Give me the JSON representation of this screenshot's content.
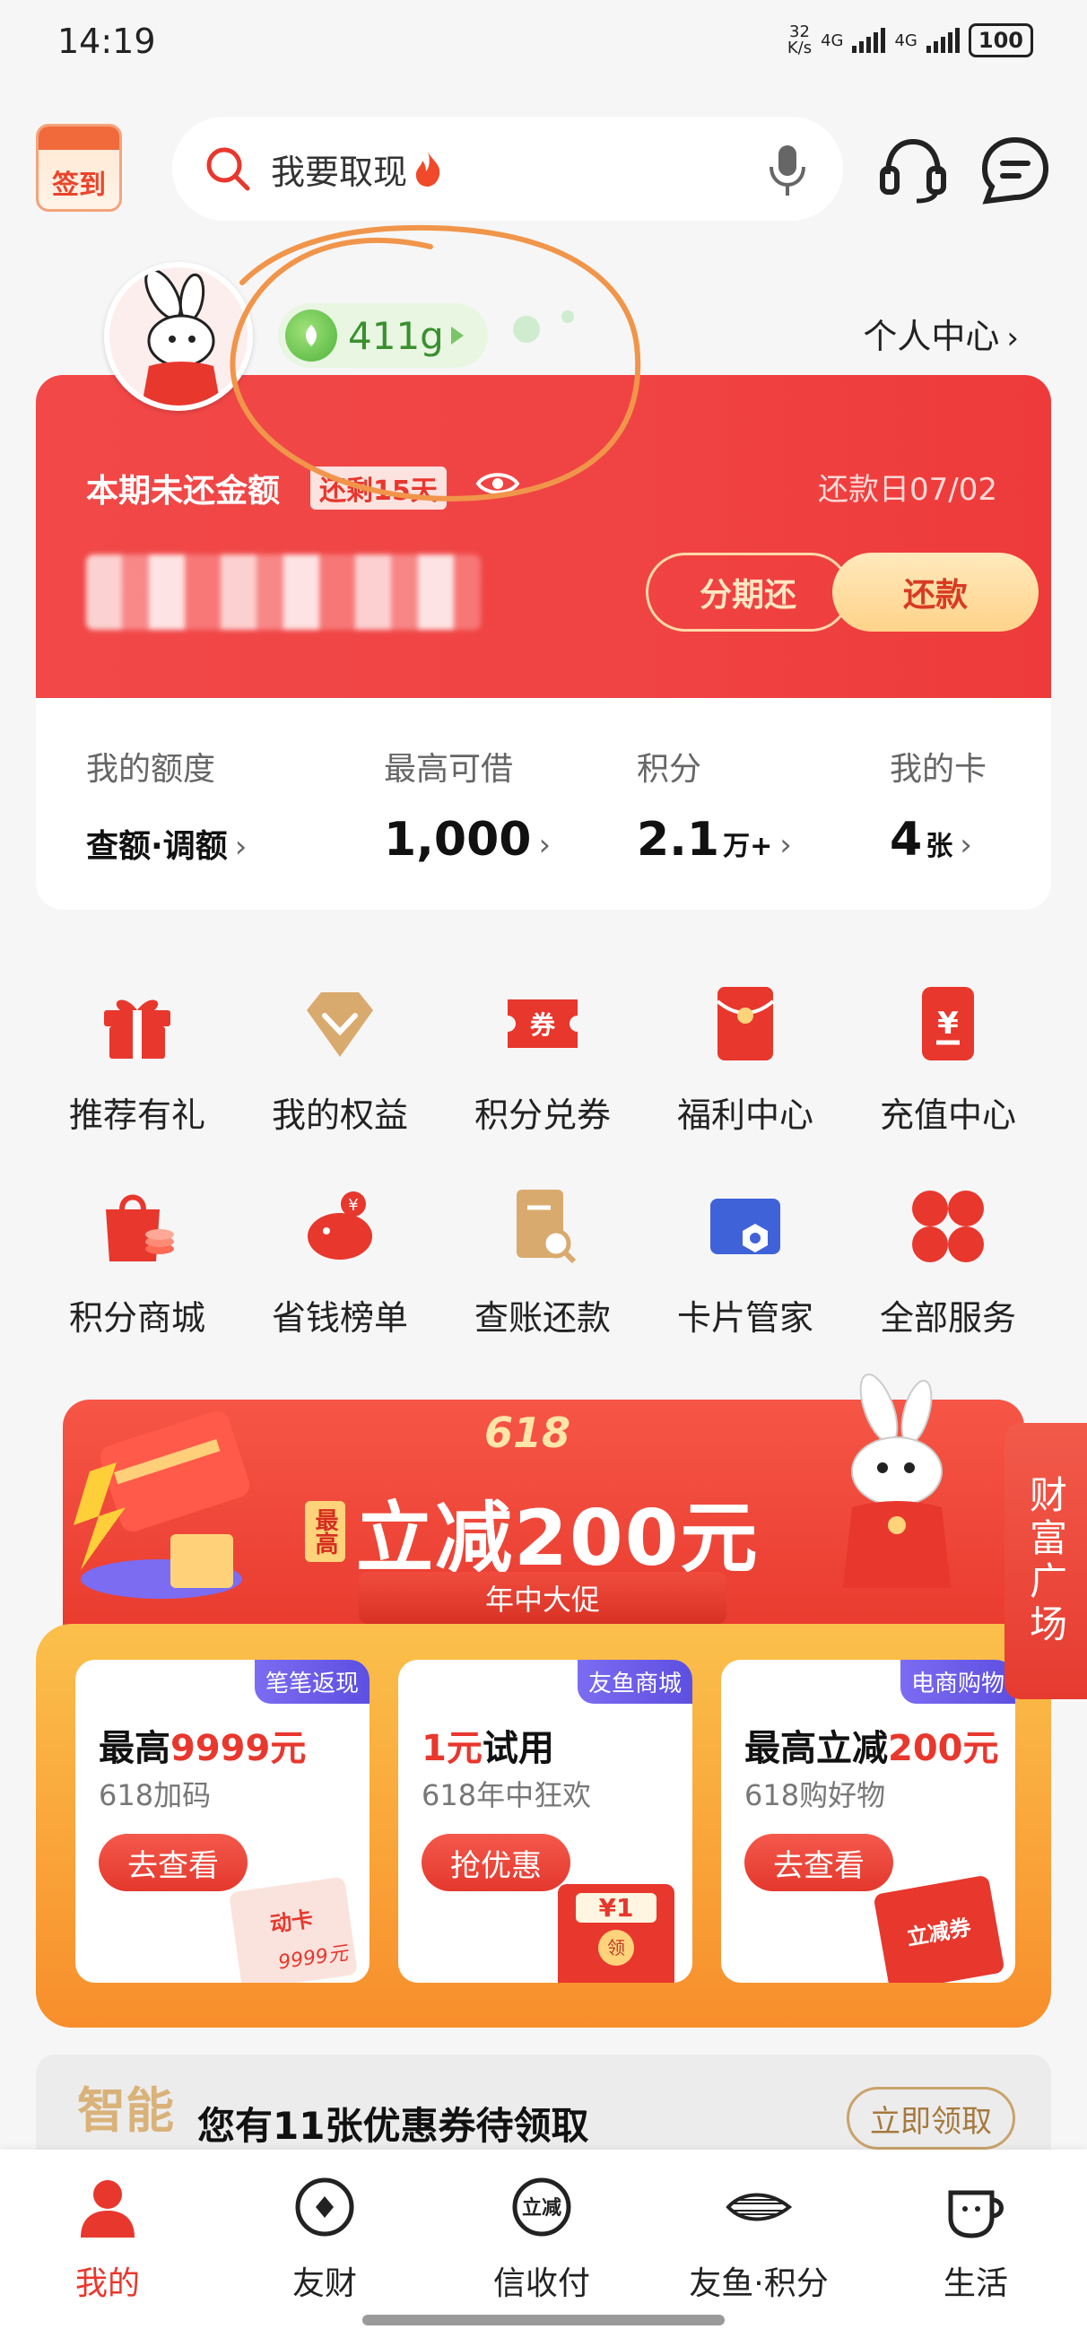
{
  "status_bar": {
    "time": "14:19",
    "net_speed": "32\nK/s",
    "net1": "4G",
    "net2": "4G",
    "battery": "100"
  },
  "header": {
    "checkin_label": "签到",
    "search_placeholder": "我要取现",
    "personal_center": "个人中心"
  },
  "profile": {
    "energy": "411g"
  },
  "bill": {
    "label": "本期未还金额",
    "remaining": "还剩15天",
    "due_date": "还款日07/02",
    "installment_button": "分期还",
    "repay_button": "还款"
  },
  "stats": [
    {
      "label": "我的额度",
      "value": "查额·调额",
      "unit": ""
    },
    {
      "label": "最高可借",
      "value": "1,000",
      "unit": ""
    },
    {
      "label": "积分",
      "value": "2.1",
      "unit": "万+"
    },
    {
      "label": "我的卡",
      "value": "4",
      "unit": "张"
    }
  ],
  "services": [
    {
      "label": "推荐有礼",
      "icon": "gift-icon"
    },
    {
      "label": "我的权益",
      "icon": "diamond-icon"
    },
    {
      "label": "积分兑券",
      "icon": "coupon-icon"
    },
    {
      "label": "福利中心",
      "icon": "red-envelope-icon"
    },
    {
      "label": "充值中心",
      "icon": "recharge-icon"
    },
    {
      "label": "积分商城",
      "icon": "shopping-bag-icon"
    },
    {
      "label": "省钱榜单",
      "icon": "piggy-bank-icon"
    },
    {
      "label": "查账还款",
      "icon": "bill-search-icon"
    },
    {
      "label": "卡片管家",
      "icon": "card-manager-icon"
    },
    {
      "label": "全部服务",
      "icon": "all-services-icon"
    }
  ],
  "promo": {
    "event": "618",
    "tag": "最高",
    "headline": "立减200元",
    "subtitle": "年中大促",
    "offers": [
      {
        "tag": "笔笔返现",
        "title_prefix": "最高",
        "title_highlight": "9999元",
        "title_suffix": "",
        "sub": "618加码",
        "button": "去查看",
        "deco": "动卡",
        "deco2": "9999元"
      },
      {
        "tag": "友鱼商城",
        "title_prefix": "",
        "title_highlight": "1元",
        "title_suffix": "试用",
        "sub": "618年中狂欢",
        "button": "抢优惠",
        "deco": "¥1",
        "deco2": "领"
      },
      {
        "tag": "电商购物",
        "title_prefix": "最高立减",
        "title_highlight": "200元",
        "title_suffix": "",
        "sub": "618购好物",
        "button": "去查看",
        "deco": "立减券",
        "deco2": ""
      }
    ]
  },
  "wealth_tab": "财富广场",
  "coupon_bar": {
    "logo": "智能",
    "text": "您有11张优惠券待领取",
    "button": "立即领取"
  },
  "bottom_nav": [
    {
      "label": "我的",
      "active": true
    },
    {
      "label": "友财",
      "active": false
    },
    {
      "label": "信收付",
      "active": false
    },
    {
      "label": "友鱼·积分",
      "active": false
    },
    {
      "label": "生活",
      "active": false
    }
  ],
  "colors": {
    "brand_red": "#e8372d",
    "energy_green": "#4fb33a",
    "annotation_orange": "#f0954a"
  }
}
